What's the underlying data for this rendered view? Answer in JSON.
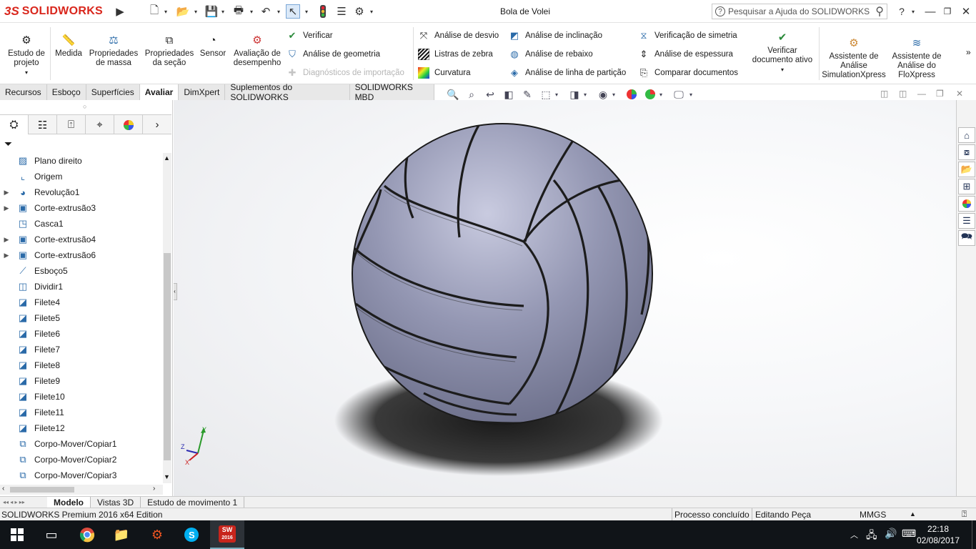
{
  "app": {
    "brand_prefix": "3S",
    "brand": "SOLIDWORKS",
    "document_title": "Bola de Volei"
  },
  "search": {
    "placeholder": "Pesquisar a Ajuda do SOLIDWORKS"
  },
  "ribbon": {
    "big_buttons": [
      {
        "label_line1": "Estudo de",
        "label_line2": "projeto",
        "icon": "design-study-icon"
      },
      {
        "label_line1": "Medida",
        "label_line2": "",
        "icon": "measure-icon"
      },
      {
        "label_line1": "Propriedades",
        "label_line2": "de massa",
        "icon": "mass-properties-icon"
      },
      {
        "label_line1": "Propriedades",
        "label_line2": "da seção",
        "icon": "section-properties-icon"
      },
      {
        "label_line1": "Sensor",
        "label_line2": "",
        "icon": "sensor-icon"
      },
      {
        "label_line1": "Avaliação de",
        "label_line2": "desempenho",
        "icon": "performance-evaluation-icon"
      }
    ],
    "check_group": [
      {
        "label": "Verificar",
        "icon": "check-icon",
        "enabled": true
      },
      {
        "label": "Análise de geometria",
        "icon": "geometry-analysis-icon",
        "enabled": true
      },
      {
        "label": "Diagnósticos de importação",
        "icon": "import-diagnostics-icon",
        "enabled": false
      }
    ],
    "analysis_col1": [
      {
        "label": "Análise de desvio",
        "icon": "deviation-analysis-icon"
      },
      {
        "label": "Listras de zebra",
        "icon": "zebra-stripes-icon"
      },
      {
        "label": "Curvatura",
        "icon": "curvature-icon"
      }
    ],
    "analysis_col2": [
      {
        "label": "Análise de inclinação",
        "icon": "draft-analysis-icon"
      },
      {
        "label": "Análise de rebaixo",
        "icon": "undercut-analysis-icon"
      },
      {
        "label": "Análise de linha de partição",
        "icon": "parting-line-analysis-icon"
      }
    ],
    "analysis_col3": [
      {
        "label": "Verificação de simetria",
        "icon": "symmetry-check-icon"
      },
      {
        "label": "Análise de espessura",
        "icon": "thickness-analysis-icon"
      },
      {
        "label": "Comparar documentos",
        "icon": "compare-documents-icon"
      }
    ],
    "verify_active": {
      "label_line1": "Verificar",
      "label_line2": "documento ativo"
    },
    "simulation": {
      "line1": "Assistente de",
      "line2": "Análise",
      "line3": "SimulationXpress"
    },
    "floxpress": {
      "line1": "Assistente de",
      "line2": "Análise do",
      "line3": "FloXpress"
    }
  },
  "command_tabs": [
    "Recursos",
    "Esboço",
    "Superfícies",
    "Avaliar",
    "DimXpert",
    "Suplementos do SOLIDWORKS",
    "SOLIDWORKS MBD"
  ],
  "active_command_tab": "Avaliar",
  "feature_tree": [
    {
      "label": "Plano direito",
      "icon": "plane-icon",
      "expandable": false
    },
    {
      "label": "Origem",
      "icon": "origin-icon",
      "expandable": false
    },
    {
      "label": "Revolução1",
      "icon": "revolve-icon",
      "expandable": true
    },
    {
      "label": "Corte-extrusão3",
      "icon": "cut-extrude-icon",
      "expandable": true
    },
    {
      "label": "Casca1",
      "icon": "shell-icon",
      "expandable": false
    },
    {
      "label": "Corte-extrusão4",
      "icon": "cut-extrude-icon",
      "expandable": true
    },
    {
      "label": "Corte-extrusão6",
      "icon": "cut-extrude-icon",
      "expandable": true
    },
    {
      "label": "Esboço5",
      "icon": "sketch-icon",
      "expandable": false
    },
    {
      "label": "Dividir1",
      "icon": "split-icon",
      "expandable": false
    },
    {
      "label": "Filete4",
      "icon": "fillet-icon",
      "expandable": false
    },
    {
      "label": "Filete5",
      "icon": "fillet-icon",
      "expandable": false
    },
    {
      "label": "Filete6",
      "icon": "fillet-icon",
      "expandable": false
    },
    {
      "label": "Filete7",
      "icon": "fillet-icon",
      "expandable": false
    },
    {
      "label": "Filete8",
      "icon": "fillet-icon",
      "expandable": false
    },
    {
      "label": "Filete9",
      "icon": "fillet-icon",
      "expandable": false
    },
    {
      "label": "Filete10",
      "icon": "fillet-icon",
      "expandable": false
    },
    {
      "label": "Filete11",
      "icon": "fillet-icon",
      "expandable": false
    },
    {
      "label": "Filete12",
      "icon": "fillet-icon",
      "expandable": false
    },
    {
      "label": "Corpo-Mover/Copiar1",
      "icon": "move-copy-body-icon",
      "expandable": false
    },
    {
      "label": "Corpo-Mover/Copiar2",
      "icon": "move-copy-body-icon",
      "expandable": false
    },
    {
      "label": "Corpo-Mover/Copiar3",
      "icon": "move-copy-body-icon",
      "expandable": false
    }
  ],
  "bottom_tabs": [
    "Modelo",
    "Vistas 3D",
    "Estudo de movimento 1"
  ],
  "active_bottom_tab": "Modelo",
  "status": {
    "edition": "SOLIDWORKS Premium 2016 x64 Edition",
    "process": "Processo concluído",
    "mode": "Editando Peça",
    "units": "MMGS"
  },
  "taskbar": {
    "time": "22:18",
    "date": "02/08/2017",
    "sw_badge": "SW",
    "sw_year": "2016"
  },
  "colors": {
    "brand_red": "#d9261c",
    "ball_fill": "#8f92ad",
    "taskbar_bg": "#101418"
  }
}
